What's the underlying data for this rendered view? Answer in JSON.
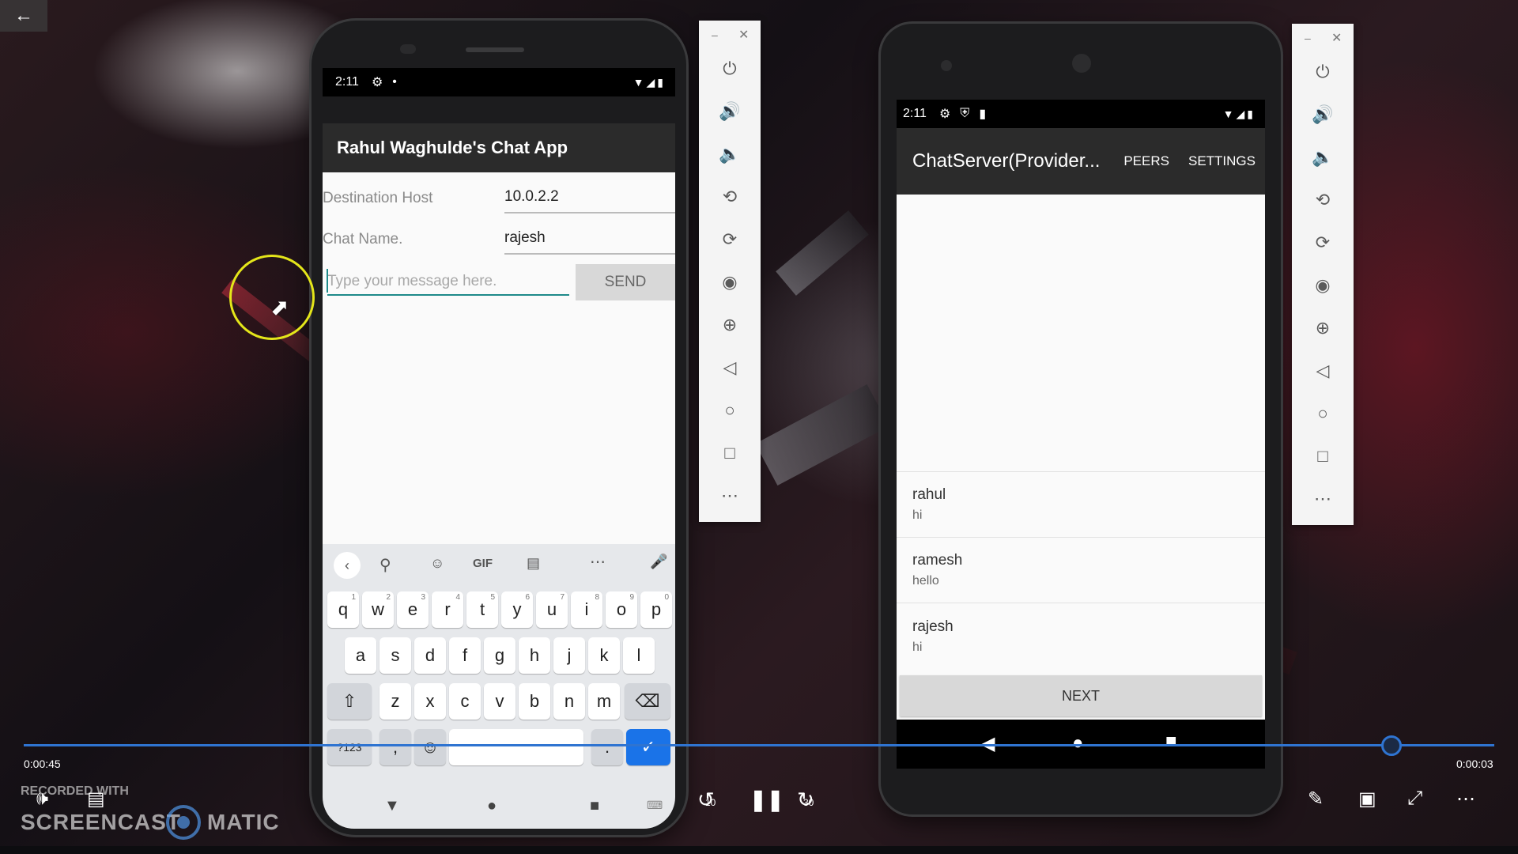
{
  "player": {
    "back_icon": "back-arrow-icon",
    "time_current": "0:00:45",
    "time_remaining": "0:00:03",
    "progress": 0.93,
    "controls": {
      "volume_icon": "volume-icon",
      "captions_icon": "captions-icon",
      "rewind_label": "10",
      "pause_icon": "pause-icon",
      "forward_label": "30",
      "edit_icon": "pencil-icon",
      "miniplayer_icon": "miniplayer-icon",
      "exit_fullscreen_icon": "exit-fullscreen-icon",
      "more_icon": "more-icon"
    }
  },
  "watermark": {
    "recorded_with": "RECORDED WITH",
    "brand_left": "SCREENCAST",
    "brand_right": "MATIC"
  },
  "left_phone": {
    "status": {
      "time": "2:11",
      "settings_icon": "gear-icon",
      "dot": "•"
    },
    "app_title": "Rahul Waghulde's Chat App",
    "destination_label": "Destination Host",
    "destination_value": "10.0.2.2",
    "chat_name_label": "Chat Name.",
    "chat_name_value": "rajesh",
    "message_placeholder": "Type your message here.",
    "send_label": "SEND",
    "keyboard": {
      "toolbar": [
        "<",
        "search",
        "sticker",
        "GIF",
        "clipboard",
        "...",
        "mic"
      ],
      "gif_label": "GIF",
      "row1": [
        [
          "q",
          "1"
        ],
        [
          "w",
          "2"
        ],
        [
          "e",
          "3"
        ],
        [
          "r",
          "4"
        ],
        [
          "t",
          "5"
        ],
        [
          "y",
          "6"
        ],
        [
          "u",
          "7"
        ],
        [
          "i",
          "8"
        ],
        [
          "o",
          "9"
        ],
        [
          "p",
          "0"
        ]
      ],
      "row2": [
        "a",
        "s",
        "d",
        "f",
        "g",
        "h",
        "j",
        "k",
        "l"
      ],
      "row3": [
        "z",
        "x",
        "c",
        "v",
        "b",
        "n",
        "m"
      ],
      "sym_label": "?123",
      "comma": ",",
      "period": "."
    }
  },
  "emulator_toolbar_icons": [
    "power-icon",
    "volume-up-icon",
    "volume-down-icon",
    "rotate-left-icon",
    "rotate-right-icon",
    "camera-icon",
    "zoom-icon",
    "back-icon",
    "home-icon",
    "overview-icon",
    "more-icon"
  ],
  "right_phone": {
    "status": {
      "time": "2:11"
    },
    "app_title": "ChatServer(Provider...",
    "menu": [
      "PEERS",
      "SETTINGS"
    ],
    "messages": [
      {
        "name": "rahul",
        "text": "hi"
      },
      {
        "name": "ramesh",
        "text": "hello"
      },
      {
        "name": "rajesh",
        "text": "hi"
      }
    ],
    "next_label": "NEXT"
  }
}
